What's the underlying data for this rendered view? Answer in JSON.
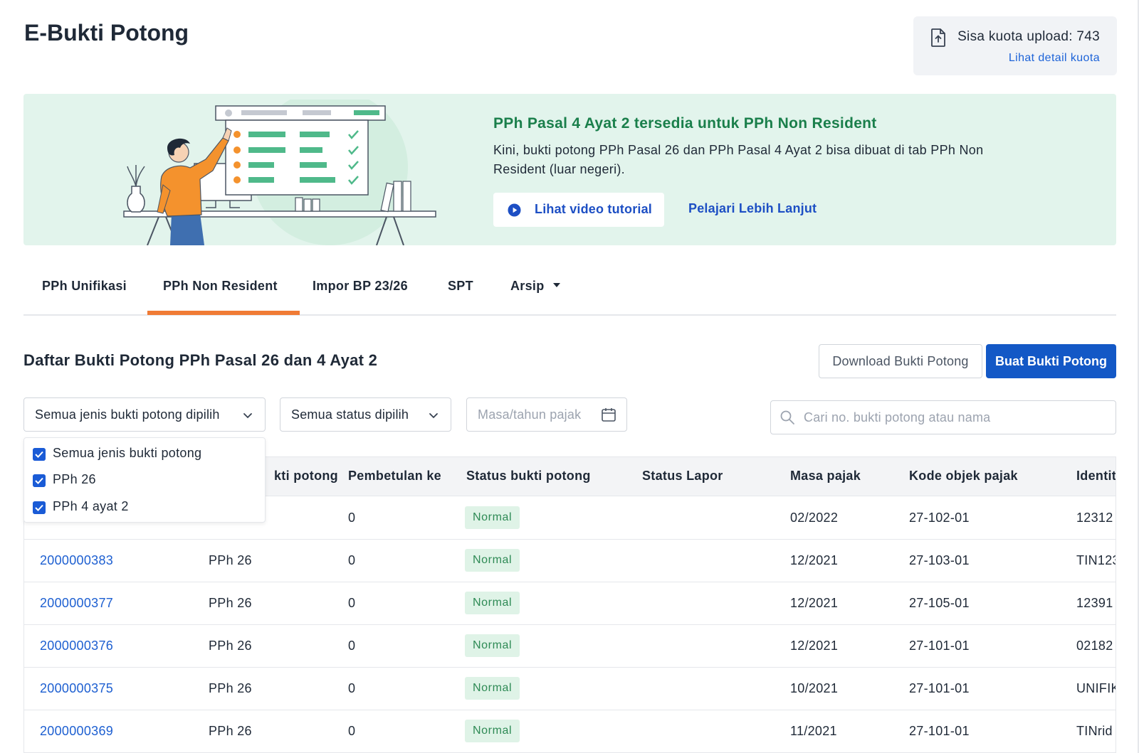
{
  "page": {
    "title": "E-Bukti Potong"
  },
  "quota": {
    "text": "Sisa kuota upload: 743",
    "link": "Lihat detail kuota"
  },
  "banner": {
    "title": "PPh Pasal 4 Ayat 2 tersedia untuk PPh Non Resident",
    "description": "Kini, bukti potong PPh Pasal 26 dan PPh Pasal 4 Ayat 2 bisa dibuat di tab PPh Non Resident (luar negeri).",
    "video_button": "Lihat video tutorial",
    "learn_more": "Pelajari Lebih Lanjut"
  },
  "tabs": [
    {
      "label": "PPh Unifikasi",
      "active": false
    },
    {
      "label": "PPh Non Resident",
      "active": true
    },
    {
      "label": "Impor BP 23/26",
      "active": false
    },
    {
      "label": "SPT",
      "active": false
    },
    {
      "label": "Arsip",
      "active": false,
      "dropdown": true
    }
  ],
  "section": {
    "title": "Daftar Bukti Potong PPh Pasal 26 dan 4 Ayat 2",
    "download_button": "Download Bukti Potong",
    "create_button": "Buat Bukti Potong"
  },
  "filters": {
    "type_select": "Semua jenis bukti potong dipilih",
    "status_select": "Semua status dipilih",
    "period_placeholder": "Masa/tahun pajak",
    "search_placeholder": "Cari no. bukti potong atau nama"
  },
  "type_dropdown": {
    "options": [
      {
        "label": "Semua jenis bukti potong",
        "checked": true
      },
      {
        "label": "PPh 26",
        "checked": true
      },
      {
        "label": "PPh 4 ayat 2",
        "checked": true
      }
    ]
  },
  "table": {
    "headers": {
      "type": "Jenis bukti potong",
      "type_visible": "kti potong",
      "revision": "Pembetulan ke",
      "status": "Status bukti potong",
      "report": "Status Lapor",
      "period": "Masa pajak",
      "code": "Kode objek pajak",
      "identity": "Identit"
    },
    "rows": [
      {
        "number": "",
        "type": "",
        "revision": "0",
        "status": "Normal",
        "report": "",
        "period": "02/2022",
        "code": "27-102-01",
        "identity": "12312"
      },
      {
        "number": "2000000383",
        "type": "PPh 26",
        "revision": "0",
        "status": "Normal",
        "report": "",
        "period": "12/2021",
        "code": "27-103-01",
        "identity": "TIN123"
      },
      {
        "number": "2000000377",
        "type": "PPh 26",
        "revision": "0",
        "status": "Normal",
        "report": "",
        "period": "12/2021",
        "code": "27-105-01",
        "identity": "12391"
      },
      {
        "number": "2000000376",
        "type": "PPh 26",
        "revision": "0",
        "status": "Normal",
        "report": "",
        "period": "12/2021",
        "code": "27-101-01",
        "identity": "02182"
      },
      {
        "number": "2000000375",
        "type": "PPh 26",
        "revision": "0",
        "status": "Normal",
        "report": "",
        "period": "10/2021",
        "code": "27-101-01",
        "identity": "UNIFIK"
      },
      {
        "number": "2000000369",
        "type": "PPh 26",
        "revision": "0",
        "status": "Normal",
        "report": "",
        "period": "11/2021",
        "code": "27-101-01",
        "identity": "TINrid"
      }
    ]
  },
  "colors": {
    "primary": "#1358c6",
    "link": "#1d5fd1",
    "tab_indicator": "#f07b35",
    "banner_bg": "#e2f4ec",
    "banner_title": "#1a7f4b",
    "badge_bg": "#dff3e7",
    "badge_text": "#2e8a55"
  },
  "icons": {
    "quota": "upload-file-icon",
    "video": "play-circle-icon",
    "select": "chevron-down-icon",
    "date": "calendar-icon",
    "search": "search-icon",
    "checkbox": "checkbox-checked-icon"
  }
}
